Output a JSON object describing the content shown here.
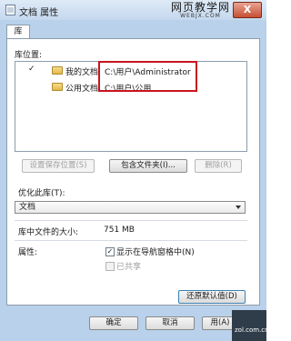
{
  "window": {
    "title": "文档 属性",
    "watermark_cn": "网页教学网",
    "watermark_url": "WEBJX.COM",
    "close_symbol": "X"
  },
  "tab": {
    "label": "库"
  },
  "library_locations": {
    "label": "库位置:",
    "items": [
      {
        "checked": true,
        "check_mark": "✓",
        "name": "我的文档",
        "path": "C:\\用户\\Administrator"
      },
      {
        "checked": false,
        "check_mark": "",
        "name": "公用文档",
        "path": "C:\\用户\\公用"
      }
    ]
  },
  "buttons": {
    "set_save_location": "设置保存位置(S)",
    "include_folder": "包含文件夹(I)...",
    "remove": "删除(R)",
    "restore_defaults": "还原默认值(D)",
    "ok": "确定",
    "cancel": "取消",
    "apply": "用(A)"
  },
  "optimize": {
    "label": "优化此库(T):",
    "selected": "文档"
  },
  "size": {
    "label": "库中文件的大小:",
    "value": "751 MB"
  },
  "attributes": {
    "label": "属性:",
    "show_in_nav": {
      "label": "显示在导航窗格中(N)",
      "checked": true,
      "mark": "✓"
    },
    "shared": {
      "label": "已共享",
      "checked": false
    }
  },
  "corner_logo": {
    "text": "zol.com.cn"
  },
  "colors": {
    "highlight": "#c8141e",
    "window_bg": "#b9d1ea"
  }
}
